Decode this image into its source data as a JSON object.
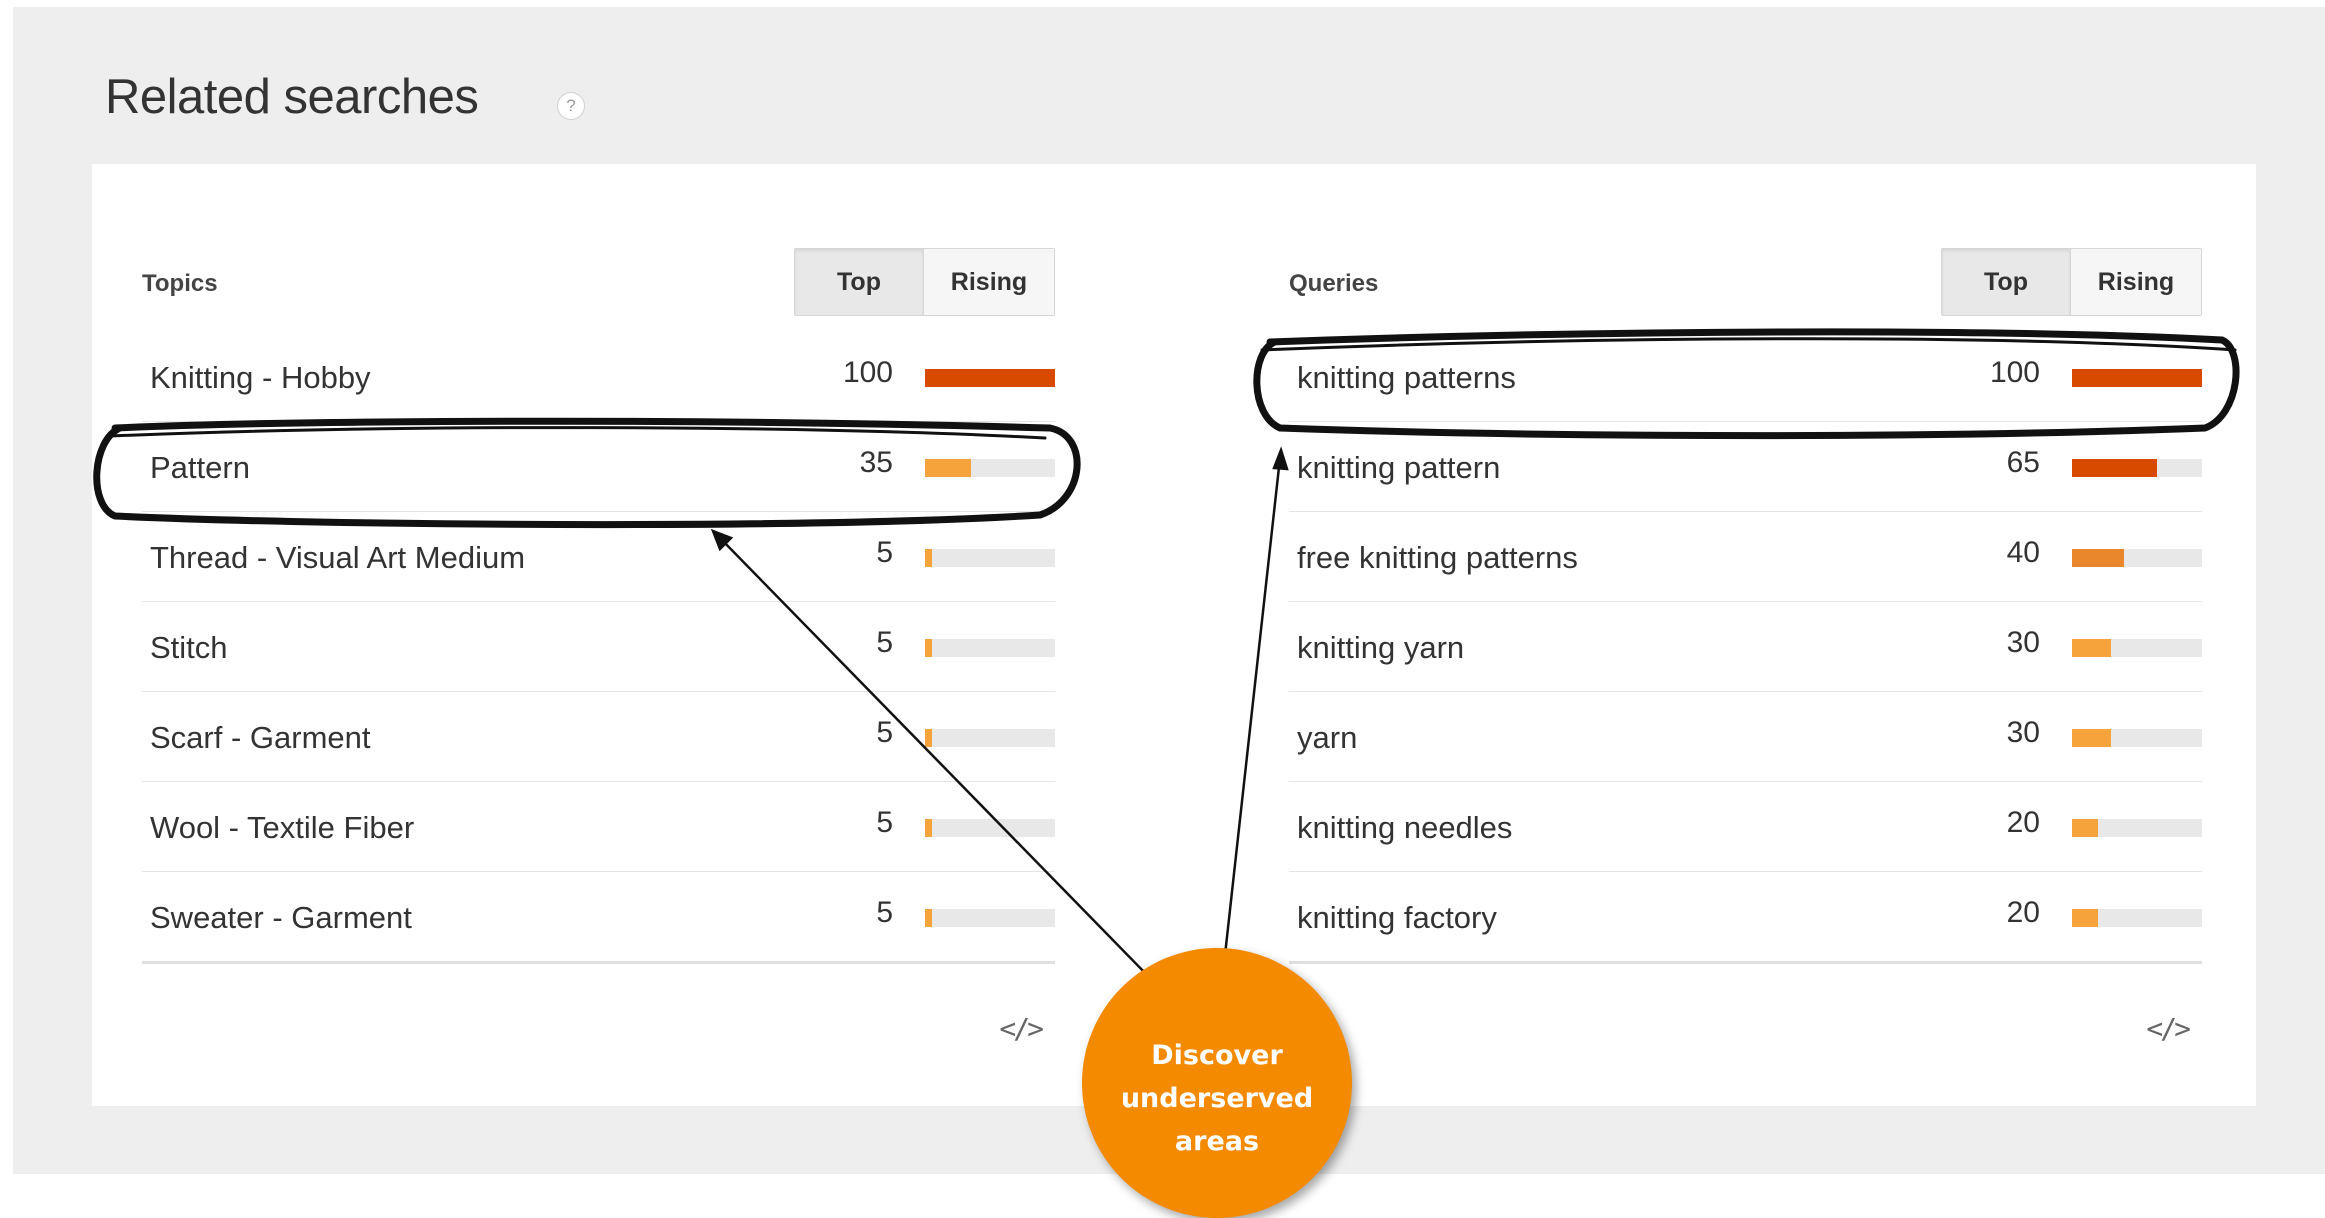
{
  "page": {
    "title": "Related searches",
    "help_icon": "?"
  },
  "topics": {
    "title": "Topics",
    "toggle": {
      "top": "Top",
      "rising": "Rising",
      "selected": "Top"
    },
    "rows": [
      {
        "label": "Knitting - Hobby",
        "value": "100",
        "fill": 1.0
      },
      {
        "label": "Pattern",
        "value": "35",
        "fill": 0.35
      },
      {
        "label": "Thread - Visual Art Medium",
        "value": "5",
        "fill": 0.05
      },
      {
        "label": "Stitch",
        "value": "5",
        "fill": 0.05
      },
      {
        "label": "Scarf - Garment",
        "value": "5",
        "fill": 0.05
      },
      {
        "label": "Wool - Textile Fiber",
        "value": "5",
        "fill": 0.05
      },
      {
        "label": "Sweater - Garment",
        "value": "5",
        "fill": 0.05
      }
    ],
    "embed_icon": "</>"
  },
  "queries": {
    "title": "Queries",
    "toggle": {
      "top": "Top",
      "rising": "Rising",
      "selected": "Top"
    },
    "rows": [
      {
        "label": "knitting patterns",
        "value": "100",
        "fill": 1.0
      },
      {
        "label": "knitting pattern",
        "value": "65",
        "fill": 0.65
      },
      {
        "label": "free knitting patterns",
        "value": "40",
        "fill": 0.4
      },
      {
        "label": "knitting yarn",
        "value": "30",
        "fill": 0.3
      },
      {
        "label": "yarn",
        "value": "30",
        "fill": 0.3
      },
      {
        "label": "knitting needles",
        "value": "20",
        "fill": 0.2
      },
      {
        "label": "knitting factory",
        "value": "20",
        "fill": 0.2
      }
    ],
    "embed_icon": "</>"
  },
  "callout": {
    "lines": [
      "Discover",
      "underserved",
      "areas"
    ],
    "color": "#f38a00"
  },
  "colors": {
    "bar_high": "#d84a00",
    "bar_mid": "#e8872b",
    "bar_low": "#f5a33a",
    "bar_track": "#e8e8e8"
  }
}
